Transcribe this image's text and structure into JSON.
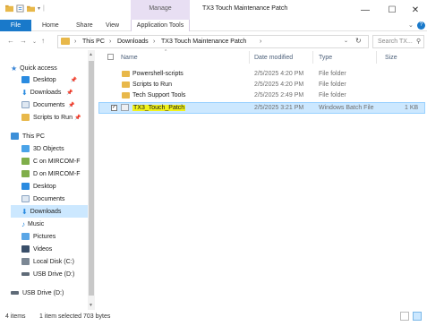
{
  "window": {
    "title": "TX3 Touch Maintenance Patch",
    "contextual_group": "Manage",
    "controls": {
      "minimize": "—",
      "maximize": "☐",
      "close": "✕"
    }
  },
  "ribbon": {
    "tabs": [
      "File",
      "Home",
      "Share",
      "View",
      "Application Tools"
    ]
  },
  "address_bar": {
    "breadcrumbs": [
      "This PC",
      "Downloads",
      "TX3 Touch Maintenance Patch"
    ],
    "separator": "›",
    "search_placeholder": "Search TX..."
  },
  "nav_pane": {
    "items": [
      {
        "label": "Quick access",
        "icon": "star-icon",
        "pinned": false
      },
      {
        "label": "Desktop",
        "icon": "desktop-icon",
        "pinned": true
      },
      {
        "label": "Downloads",
        "icon": "download-icon",
        "pinned": true
      },
      {
        "label": "Documents",
        "icon": "documents-icon",
        "pinned": true
      },
      {
        "label": "Scripts to Run",
        "icon": "folder-icon",
        "pinned": true
      },
      {
        "label": "This PC",
        "icon": "computer-icon",
        "pinned": false
      },
      {
        "label": "3D Objects",
        "icon": "cube-icon",
        "pinned": false
      },
      {
        "label": "C on MIRCOM-F",
        "icon": "network-drive-icon",
        "pinned": false
      },
      {
        "label": "D on MIRCOM-F",
        "icon": "network-drive-icon",
        "pinned": false
      },
      {
        "label": "Desktop",
        "icon": "desktop-icon",
        "pinned": false
      },
      {
        "label": "Documents",
        "icon": "documents-icon",
        "pinned": false
      },
      {
        "label": "Downloads",
        "icon": "download-icon",
        "pinned": false,
        "selected": true
      },
      {
        "label": "Music",
        "icon": "music-icon",
        "pinned": false
      },
      {
        "label": "Pictures",
        "icon": "pictures-icon",
        "pinned": false
      },
      {
        "label": "Videos",
        "icon": "videos-icon",
        "pinned": false
      },
      {
        "label": "Local Disk (C:)",
        "icon": "drive-icon",
        "pinned": false
      },
      {
        "label": "USB Drive (D:)",
        "icon": "usb-drive-icon",
        "pinned": false
      },
      {
        "label": "USB Drive (D:)",
        "icon": "usb-drive-icon",
        "pinned": false
      }
    ]
  },
  "file_list": {
    "columns": {
      "name": "Name",
      "date": "Date modified",
      "type": "Type",
      "size": "Size"
    },
    "rows": [
      {
        "name": "Powershell-scripts",
        "date": "2/5/2025 4:20 PM",
        "type": "File folder",
        "size": "",
        "icon": "folder-icon"
      },
      {
        "name": "Scripts to Run",
        "date": "2/5/2025 4:20 PM",
        "type": "File folder",
        "size": "",
        "icon": "folder-icon"
      },
      {
        "name": "Tech Support Tools",
        "date": "2/5/2025 2:49 PM",
        "type": "File folder",
        "size": "",
        "icon": "folder-icon"
      },
      {
        "name": "TX3_Touch_Patch",
        "date": "2/5/2025 3:21 PM",
        "type": "Windows Batch File",
        "size": "1 KB",
        "icon": "batch-file-icon",
        "selected": true,
        "highlighted": true
      }
    ]
  },
  "status_bar": {
    "item_count": "4 items",
    "selection": "1 item selected  703 bytes"
  },
  "colors": {
    "accent": "#1979ca",
    "selection": "#cce8ff",
    "manage_tab": "#e8dff3",
    "folder": "#e8b84a",
    "highlight": "#f1f21a"
  }
}
